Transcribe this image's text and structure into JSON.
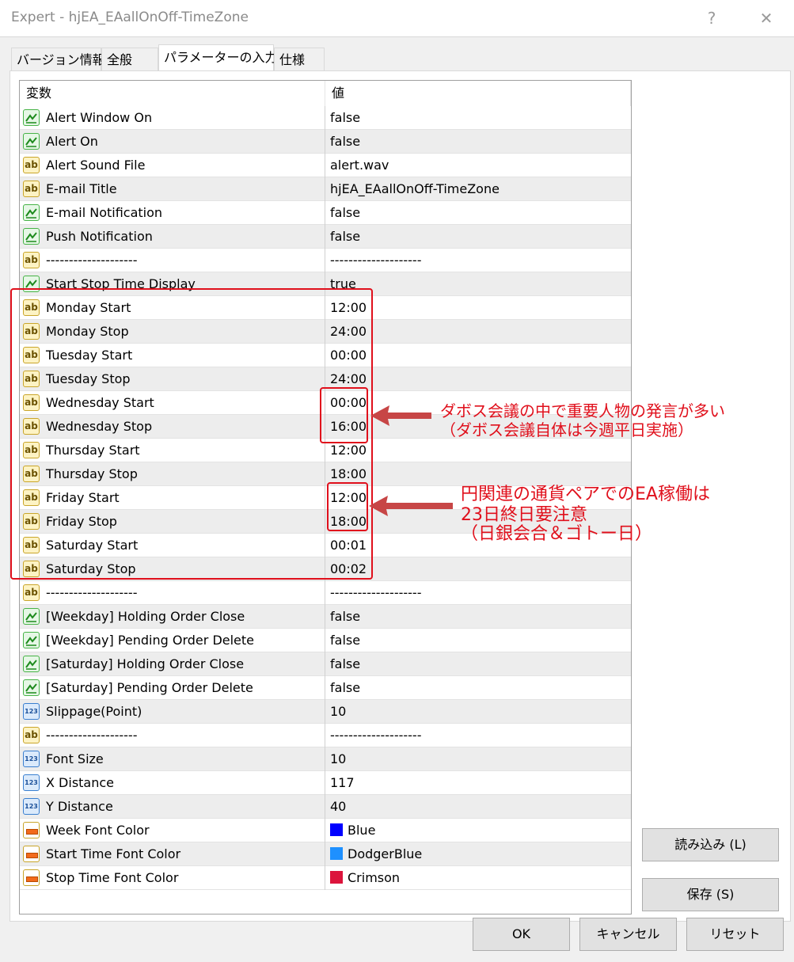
{
  "window": {
    "title": "Expert - hjEA_EAallOnOff-TimeZone",
    "help": "?",
    "close": "✕"
  },
  "tabs": [
    {
      "label": "バージョン情報"
    },
    {
      "label": "全般"
    },
    {
      "label": "パラメーターの入力"
    },
    {
      "label": "仕様"
    }
  ],
  "grid": {
    "col_variable": "変数",
    "col_value": "値",
    "rows": [
      {
        "type": "bool",
        "name": "Alert Window On",
        "value": "false"
      },
      {
        "type": "bool",
        "name": "Alert On",
        "value": "false"
      },
      {
        "type": "str",
        "name": "Alert Sound File",
        "value": "alert.wav"
      },
      {
        "type": "str",
        "name": "E-mail Title",
        "value": "hjEA_EAallOnOff-TimeZone"
      },
      {
        "type": "bool",
        "name": "E-mail Notification",
        "value": "false"
      },
      {
        "type": "bool",
        "name": "Push Notification",
        "value": "false"
      },
      {
        "type": "str",
        "name": "--------------------",
        "value": "--------------------"
      },
      {
        "type": "bool",
        "name": "Start Stop Time Display",
        "value": "true"
      },
      {
        "type": "str",
        "name": "Monday Start",
        "value": "12:00"
      },
      {
        "type": "str",
        "name": "Monday Stop",
        "value": "24:00"
      },
      {
        "type": "str",
        "name": "Tuesday Start",
        "value": "00:00"
      },
      {
        "type": "str",
        "name": "Tuesday Stop",
        "value": "24:00"
      },
      {
        "type": "str",
        "name": "Wednesday Start",
        "value": "00:00"
      },
      {
        "type": "str",
        "name": "Wednesday Stop",
        "value": "16:00"
      },
      {
        "type": "str",
        "name": "Thursday Start",
        "value": "12:00"
      },
      {
        "type": "str",
        "name": "Thursday Stop",
        "value": "18:00"
      },
      {
        "type": "str",
        "name": "Friday Start",
        "value": "12:00"
      },
      {
        "type": "str",
        "name": "Friday Stop",
        "value": "18:00"
      },
      {
        "type": "str",
        "name": "Saturday Start",
        "value": "00:01"
      },
      {
        "type": "str",
        "name": "Saturday Stop",
        "value": "00:02"
      },
      {
        "type": "str",
        "name": "--------------------",
        "value": "--------------------"
      },
      {
        "type": "bool",
        "name": "[Weekday]  Holding Order Close",
        "value": "false"
      },
      {
        "type": "bool",
        "name": "[Weekday]  Pending Order Delete",
        "value": "false"
      },
      {
        "type": "bool",
        "name": "[Saturday]   Holding Order Close",
        "value": "false"
      },
      {
        "type": "bool",
        "name": "[Saturday]   Pending Order Delete",
        "value": "false"
      },
      {
        "type": "num",
        "name": "Slippage(Point)",
        "value": "10"
      },
      {
        "type": "str",
        "name": "--------------------",
        "value": "--------------------"
      },
      {
        "type": "num",
        "name": "Font Size",
        "value": "10"
      },
      {
        "type": "num",
        "name": "X Distance",
        "value": "117"
      },
      {
        "type": "num",
        "name": "Y Distance",
        "value": "40"
      },
      {
        "type": "col",
        "name": "Week Font Color",
        "value": "Blue",
        "color": "#0000ff"
      },
      {
        "type": "col",
        "name": "Start Time Font Color",
        "value": "DodgerBlue",
        "color": "#1e90ff"
      },
      {
        "type": "col",
        "name": "Stop Time Font Color",
        "value": "Crimson",
        "color": "#dc143c"
      }
    ]
  },
  "annotations": {
    "note1_line1": "ダボス会議の中で重要人物の発言が多い",
    "note1_line2": "（ダボス会議自体は今週平日実施）",
    "note2_line1": "円関連の通貨ペアでのEA稼働は",
    "note2_line2": "23日終日要注意",
    "note2_line3": "（日銀会合＆ゴトー日）",
    "accent_color": "#e0101c"
  },
  "buttons": {
    "load": "読み込み (L)",
    "save": "保存 (S)",
    "ok": "OK",
    "cancel": "キャンセル",
    "reset": "リセット"
  }
}
